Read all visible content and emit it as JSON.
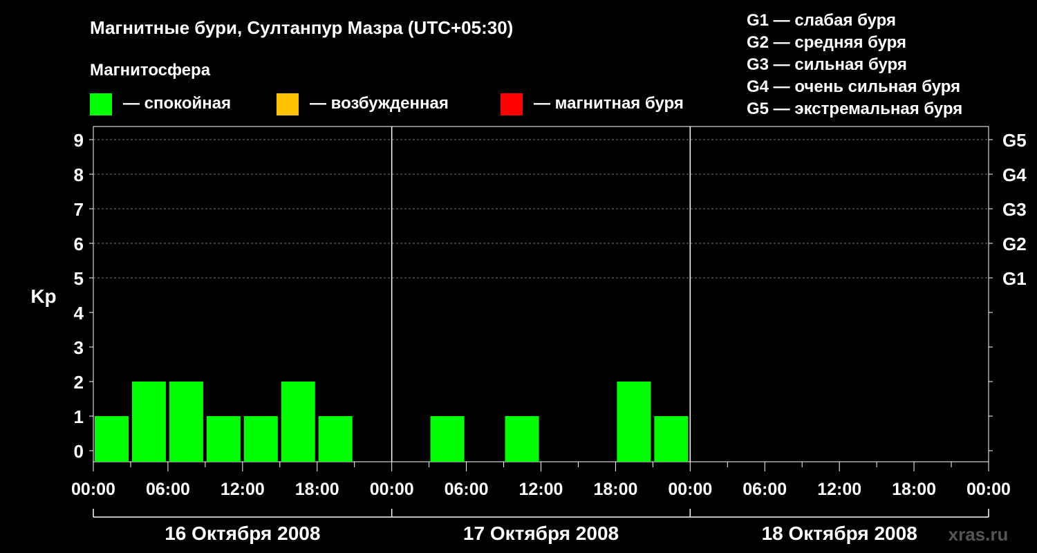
{
  "chart_data": {
    "type": "bar",
    "title": "Магнитные бури, Султанпур Мазра (UTC+05:30)",
    "legend_title": "Магнитосфера",
    "legend": [
      {
        "label": "— спокойная",
        "color": "#00ff00"
      },
      {
        "label": "— возбужденная",
        "color": "#ffc000"
      },
      {
        "label": "— магнитная буря",
        "color": "#ff0000"
      }
    ],
    "g_scale": [
      "G1 — слабая буря",
      "G2 — средняя буря",
      "G3 — сильная буря",
      "G4 — очень сильная буря",
      "G5 — экстремальная буря"
    ],
    "ylabel": "Kp",
    "ylim": [
      0,
      9
    ],
    "y_ticks": [
      "0",
      "1",
      "2",
      "3",
      "4",
      "5",
      "6",
      "7",
      "8",
      "9"
    ],
    "right_labels": [
      {
        "kp": 5,
        "label": "G1"
      },
      {
        "kp": 6,
        "label": "G2"
      },
      {
        "kp": 7,
        "label": "G3"
      },
      {
        "kp": 8,
        "label": "G4"
      },
      {
        "kp": 9,
        "label": "G5"
      }
    ],
    "x_tick_labels": [
      "00:00",
      "06:00",
      "12:00",
      "18:00",
      "00:00",
      "06:00",
      "12:00",
      "18:00",
      "00:00",
      "06:00",
      "12:00",
      "18:00",
      "00:00"
    ],
    "days": [
      "16 Октября 2008",
      "17 Октября 2008",
      "18 Октября 2008"
    ],
    "bar_color": "#00ff00",
    "grid": "dashed at Kp 5-9",
    "values": [
      [
        1,
        2,
        2,
        1,
        1,
        2,
        1,
        null
      ],
      [
        null,
        1,
        null,
        1,
        null,
        null,
        2,
        1
      ],
      [
        null,
        null,
        null,
        null,
        null,
        null,
        null,
        null
      ]
    ]
  },
  "watermark": "xras.ru"
}
